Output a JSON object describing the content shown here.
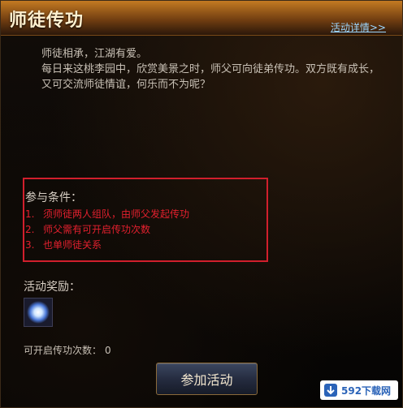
{
  "window": {
    "title": "师徒传功",
    "details_link": "活动详情>>"
  },
  "intro": {
    "line1": "师徒相承，江湖有爱。",
    "line2": "每日来这桃李园中，欣赏美景之时，师父可向徒弟传功。双方既有成长，又可交流师徒情谊，何乐而不为呢？"
  },
  "conditions": {
    "label": "参与条件：",
    "items": [
      {
        "num": "1.",
        "text": "须师徒两人组队，由师父发起传功"
      },
      {
        "num": "2.",
        "text": "师父需有可开启传功次数"
      },
      {
        "num": "3.",
        "text": "也单师徒关系"
      }
    ],
    "highlight_color": "#d11f2c"
  },
  "rewards": {
    "label": "活动奖励：",
    "icon": "glowing-orb-icon"
  },
  "count": {
    "label": "可开启传功次数：",
    "value": "0"
  },
  "actions": {
    "join_label": "参加活动"
  },
  "watermark": {
    "text": "592下载网"
  }
}
